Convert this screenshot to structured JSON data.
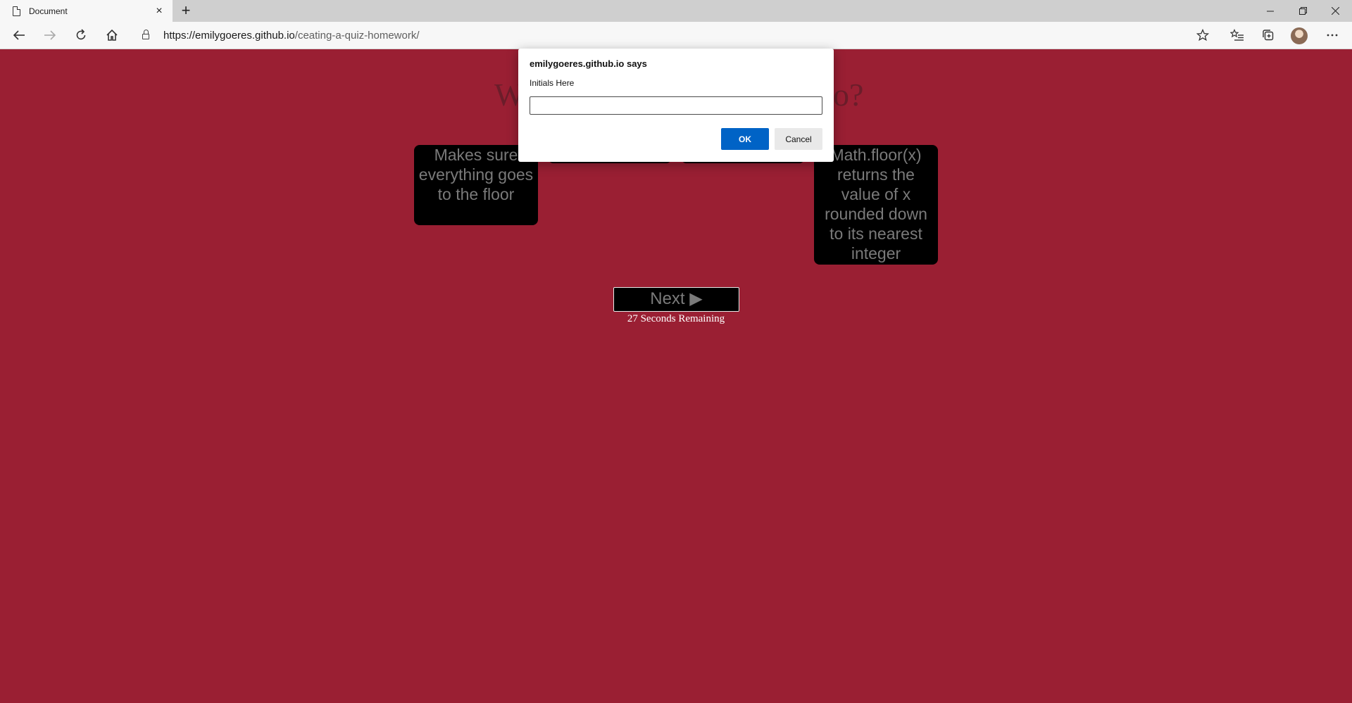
{
  "browser": {
    "tab_title": "Document",
    "tab_close": "×",
    "new_tab": "+",
    "url_host": "https://emilygoeres.github.io",
    "url_path": "/ceating-a-quiz-homework/"
  },
  "quiz": {
    "question_visible_start": "W",
    "question_visible_end": "o?",
    "answers": [
      "Makes sure everything goes to the floor",
      "",
      "",
      "Math.floor(x) returns the value of x rounded down to its nearest integer"
    ],
    "next_label": "Next ▶",
    "timer_text": "27 Seconds Remaining"
  },
  "dialog": {
    "title": "emilygoeres.github.io says",
    "message": "Initials Here",
    "input_value": "",
    "ok_label": "OK",
    "cancel_label": "Cancel"
  },
  "icons": {
    "back": "back-arrow-icon",
    "forward": "forward-arrow-icon",
    "refresh": "refresh-icon",
    "home": "home-icon",
    "favorite": "star-icon",
    "favorites": "favorites-list-icon",
    "collections": "collections-icon",
    "more": "more-icon"
  },
  "colors": {
    "page_background": "#9a1f33",
    "ok_button": "#0063c6"
  }
}
